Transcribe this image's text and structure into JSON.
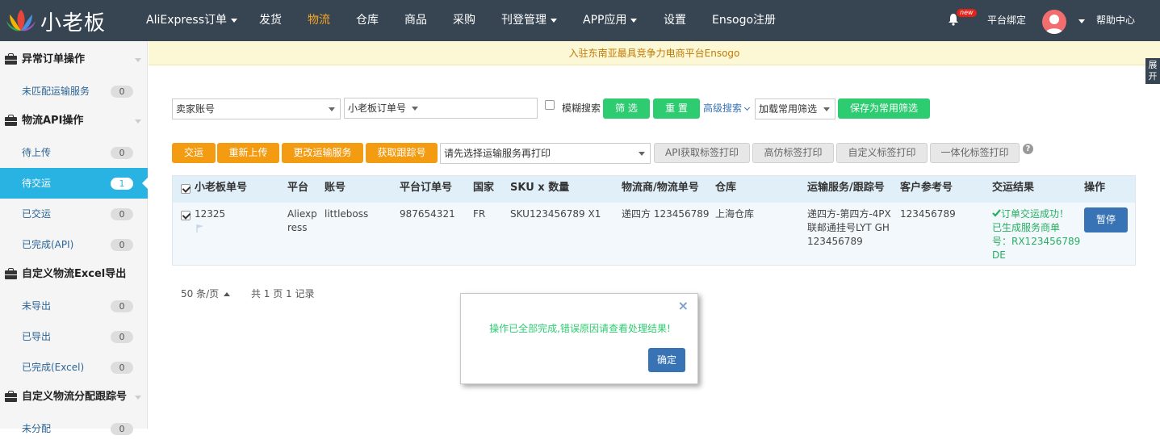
{
  "app": {
    "name": "小老板"
  },
  "nav": {
    "items": [
      {
        "label": "AliExpress订单",
        "dropdown": true
      },
      {
        "label": "发货"
      },
      {
        "label": "物流",
        "active": true
      },
      {
        "label": "仓库"
      },
      {
        "label": "商品"
      },
      {
        "label": "采购"
      },
      {
        "label": "刊登管理",
        "dropdown": true
      },
      {
        "label": "APP应用",
        "dropdown": true
      },
      {
        "label": "设置"
      },
      {
        "label": "Ensogo注册"
      }
    ],
    "badge": "new",
    "bind_label": "平台绑定",
    "help_label": "帮助中心",
    "active_color": "#f5a623"
  },
  "banner": {
    "text": "入驻东南亚最具竞争力电商平台Ensogo"
  },
  "expand_tab": {
    "line1": "展",
    "line2": "开"
  },
  "sidebar": {
    "sections": [
      {
        "title": "异常订单操作",
        "items": [
          {
            "label": "未匹配运输服务",
            "count": "0"
          }
        ]
      },
      {
        "title": "物流API操作",
        "items": [
          {
            "label": "待上传",
            "count": "0"
          },
          {
            "label": "待交运",
            "count": "1",
            "active": true
          },
          {
            "label": "已交运",
            "count": "0"
          },
          {
            "label": "已完成(API)",
            "count": "0"
          }
        ]
      },
      {
        "title": "自定义物流Excel导出",
        "items": [
          {
            "label": "未导出",
            "count": "0"
          },
          {
            "label": "已导出",
            "count": "0"
          },
          {
            "label": "已完成(Excel)",
            "count": "0"
          }
        ]
      },
      {
        "title": "自定义物流分配跟踪号",
        "items": [
          {
            "label": "未分配",
            "count": "0"
          }
        ]
      }
    ],
    "active_color": "#29b3e3"
  },
  "filters": {
    "seller_account": "卖家账号",
    "order_no_type": "小老板订单号",
    "search_value": "",
    "fuzzy_label": "模糊搜索",
    "filter_btn": "筛 选",
    "reset_btn": "重 置",
    "advanced_link": "高级搜索",
    "common_filter": "加载常用筛选",
    "save_filter_btn": "保存为常用筛选"
  },
  "actions": {
    "ship_btn": "交运",
    "reupload_btn": "重新上传",
    "change_service_btn": "更改运输服务",
    "get_tracking_btn": "获取跟踪号",
    "print_select": "请先选择运输服务再打印",
    "api_print_btn": "API获取标签打印",
    "hifi_print_btn": "高仿标签打印",
    "custom_print_btn": "自定义标签打印",
    "integrated_print_btn": "一体化标签打印",
    "help_mark": "?"
  },
  "table": {
    "headers": [
      "小老板单号",
      "平台",
      "账号",
      "平台订单号",
      "国家",
      "SKU x 数量",
      "物流商/物流单号",
      "仓库",
      "运输服务/跟踪号",
      "客户参考号",
      "交运结果",
      "操作"
    ],
    "rows": [
      {
        "order_no": "12325",
        "platform_l1": "Aliexp",
        "platform_l2": "ress",
        "account": "littleboss",
        "platform_order": "987654321",
        "country": "FR",
        "sku_qty": "SKU123456789 X1",
        "carrier": "递四方 123456789",
        "warehouse": "上海仓库",
        "service_l1": "递四方-第四方-4PX",
        "service_l2": "联邮通挂号LYT GH",
        "service_l3": "123456789",
        "customer_ref": "123456789",
        "result_l1": "订单交运成功！",
        "result_l2": "已生成服务商单",
        "result_l3": "号：RX123456789",
        "result_l4": "DE",
        "action_btn": "暂停"
      }
    ]
  },
  "pagination": {
    "per_page": "50 条/页",
    "summary": "共 1 页 1 记录"
  },
  "dialog": {
    "message": "操作已全部完成,错误原因请查看处理结果!",
    "ok_btn": "确定",
    "close_glyph": "×"
  }
}
